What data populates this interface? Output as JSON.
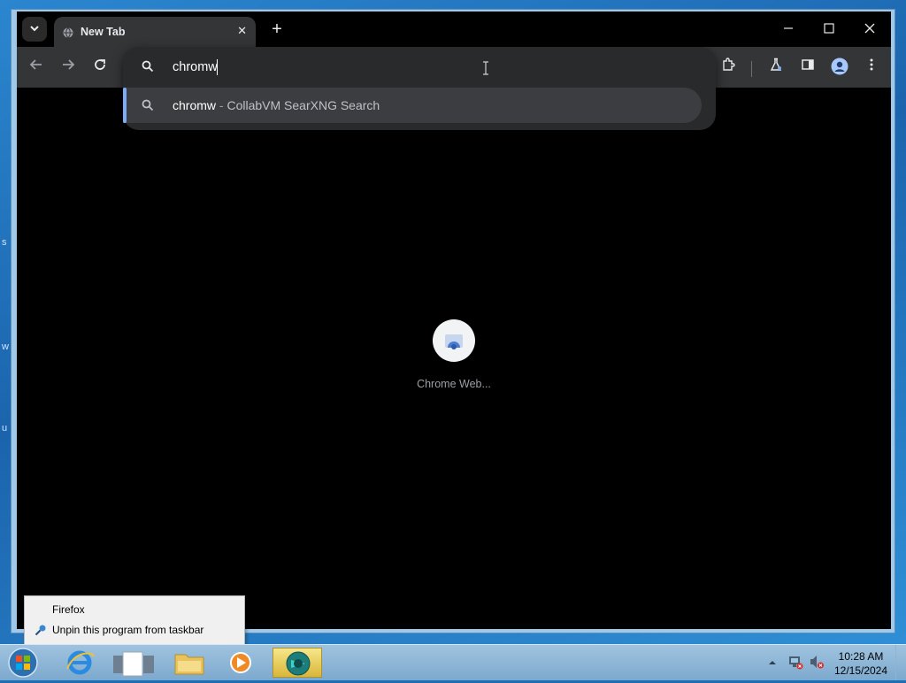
{
  "browser": {
    "tab": {
      "title": "New Tab",
      "close": "✕"
    },
    "new_tab": "+",
    "window_controls": {
      "minimize": "—",
      "maximize": "☐",
      "close": "✕"
    },
    "omnibox": {
      "value": "chromw",
      "suggestion": {
        "query": "chromw",
        "separator": " - ",
        "engine": "CollabVM SearXNG Search"
      }
    },
    "shortcut": {
      "label": "Chrome Web..."
    }
  },
  "context_menu": {
    "items": [
      {
        "label": "Firefox"
      },
      {
        "label": "Unpin this program from taskbar"
      }
    ]
  },
  "taskbar": {
    "clock": {
      "time": "10:28 AM",
      "date": "12/15/2024"
    },
    "apps": [
      "internet-explorer",
      "document",
      "file-explorer",
      "media-player",
      "chrome-app"
    ]
  },
  "colors": {
    "accent": "#7cacf8",
    "toolbar": "#333537",
    "content_bg": "#000000"
  }
}
